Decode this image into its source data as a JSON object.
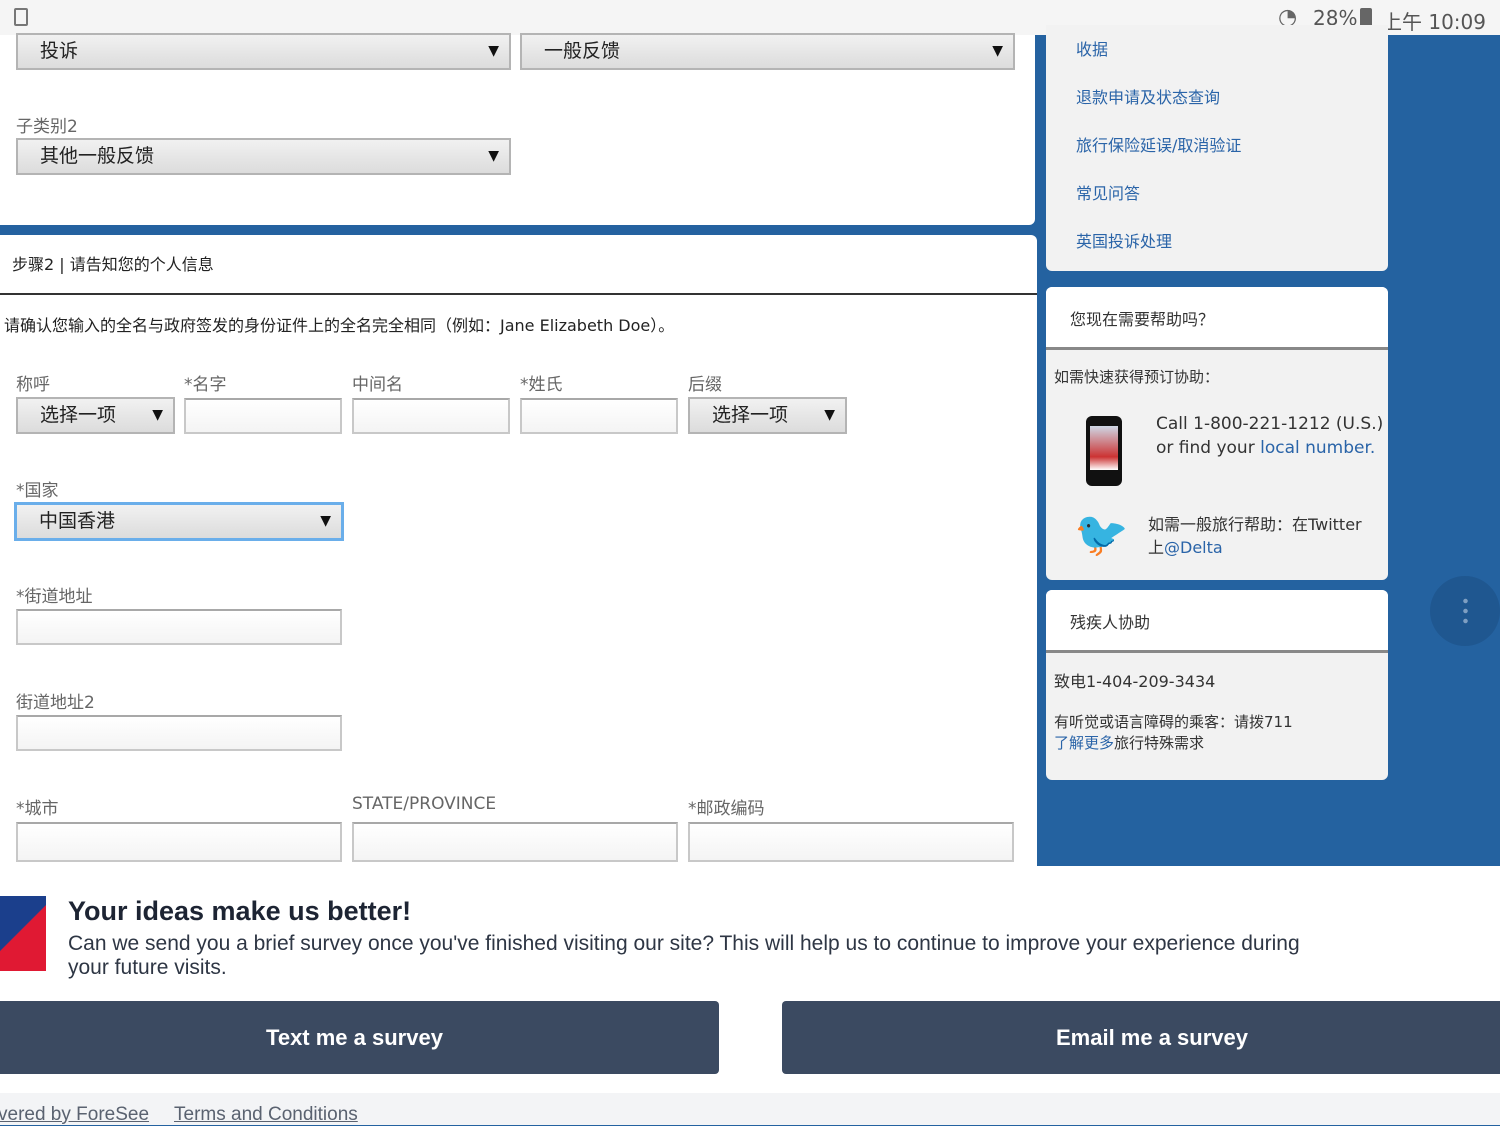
{
  "status_bar": {
    "battery": "28%",
    "time": "上午 10:09"
  },
  "form": {
    "category": "投诉",
    "subcategory": "一般反馈",
    "subcategory2_label": "子类别2",
    "subcategory2": "其他一般反馈",
    "step2_title": "步骤2 | 请告知您的个人信息",
    "name_notice": "请确认您输入的全名与政府签发的身份证件上的全名完全相同（例如：Jane Elizabeth Doe）。",
    "fields": {
      "salutation_label": "称呼",
      "salutation_value": "选择一项",
      "first_name_label": "*名字",
      "middle_name_label": "中间名",
      "last_name_label": "*姓氏",
      "suffix_label": "后缀",
      "suffix_value": "选择一项",
      "country_label": "*国家",
      "country_value": "中国香港",
      "street_label": "*街道地址",
      "street2_label": "街道地址2",
      "city_label": "*城市",
      "state_label": "STATE/PROVINCE",
      "postal_label": "*邮政编码"
    }
  },
  "sidebar": {
    "links": [
      "收据",
      "退款申请及状态查询",
      "旅行保险延误/取消验证",
      "常见问答",
      "英国投诉处理"
    ],
    "help": {
      "title": "您现在需要帮助吗？",
      "booking_text": "如需快速获得预订协助：",
      "call_line1": "Call 1-800-221-1212 (U.S.)",
      "call_line2_prefix": "or find your ",
      "call_link": "local number.",
      "twitter_text": "如需一般旅行帮助：在Twitter",
      "twitter_prefix": "上",
      "twitter_handle": "@Delta"
    },
    "disability": {
      "title": "残疾人协助",
      "phone": "致电1-404-209-3434",
      "hearing": "有听觉或语言障碍的乘客：请拨711",
      "learn_more": "了解更多",
      "learn_more_suffix": "旅行特殊需求"
    }
  },
  "survey": {
    "title": "Your ideas make us better!",
    "body": "Can we send you a brief survey once you've finished visiting our site? This will help us to continue to improve your experience during your future visits.",
    "text_button": "Text me a survey",
    "email_button": "Email me a survey",
    "powered_by": "vered by ForeSee",
    "terms": "Terms and Conditions"
  },
  "colors": {
    "brand_blue": "#2462a0",
    "link": "#2a64a8",
    "button": "#3b4a61"
  }
}
